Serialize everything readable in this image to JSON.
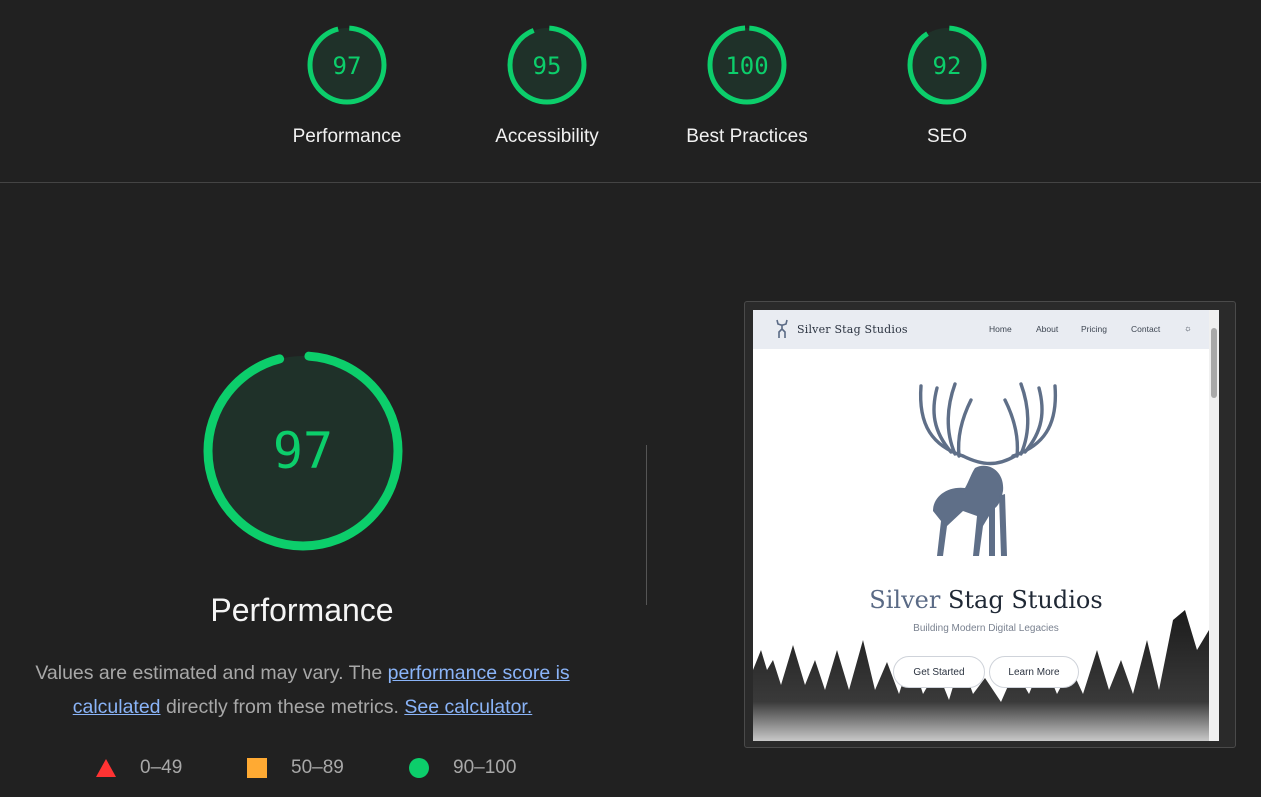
{
  "scores": [
    {
      "value": "97",
      "label": "Performance",
      "fraction": 0.97
    },
    {
      "value": "95",
      "label": "Accessibility",
      "fraction": 0.95
    },
    {
      "value": "100",
      "label": "Best Practices",
      "fraction": 1.0
    },
    {
      "value": "92",
      "label": "SEO",
      "fraction": 0.92
    }
  ],
  "main": {
    "score": "97",
    "fraction": 0.97,
    "title": "Performance",
    "desc_prefix": "Values are estimated and may vary. The ",
    "desc_link1": "performance score is calculated",
    "desc_middle": " directly from these metrics. ",
    "desc_link2": "See calculator."
  },
  "legend": [
    {
      "icon": "triangle-icon",
      "range": "0–49",
      "color": "#ff3333"
    },
    {
      "icon": "square-icon",
      "range": "50–89",
      "color": "#ffaa33"
    },
    {
      "icon": "circle-icon",
      "range": "90–100",
      "color": "#0cce6b"
    }
  ],
  "colors": {
    "pass": "#0cce6b",
    "pass_bg": "#1f3129"
  },
  "screenshot": {
    "brand": "Silver Stag Studios",
    "nav": [
      "Home",
      "About",
      "Pricing",
      "Contact"
    ],
    "hero_word1": "Silver",
    "hero_word2": " Stag Studios",
    "subtitle": "Building Modern Digital Legacies",
    "cta_primary": "Get Started",
    "cta_secondary": "Learn More"
  }
}
